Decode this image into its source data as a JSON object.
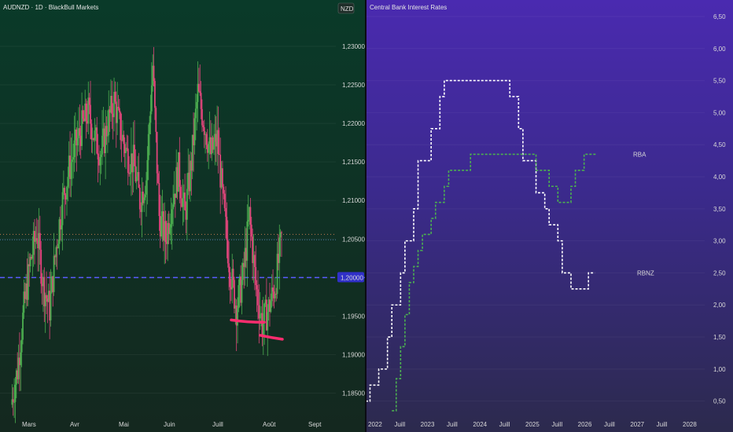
{
  "left_chart": {
    "title": "AUDNZD · 1D · BlackBull Markets",
    "currency": "NZD",
    "y_ticks": [
      "1,18500",
      "1,19000",
      "1,19500",
      "1,20000",
      "1,20500",
      "1,21000",
      "1,21500",
      "1,22000",
      "1,22500",
      "1,23000"
    ],
    "x_ticks": [
      "Mars",
      "Avr",
      "Mai",
      "Juin",
      "Juill",
      "Août",
      "Sept"
    ],
    "price_label": "1,20000",
    "colors": {
      "up": "#4caf50",
      "down": "#e0457b",
      "level": "#5b5bff",
      "marker": "#ff2d6f",
      "text": "#d8d8d8"
    }
  },
  "right_chart": {
    "title": "Central Bank Interest Rates",
    "y_ticks": [
      "0,50",
      "1,00",
      "1,50",
      "2,00",
      "2,50",
      "3,00",
      "3,50",
      "4,00",
      "4,50",
      "5,00",
      "5,50",
      "6,00",
      "6,50"
    ],
    "x_ticks": [
      "2022",
      "Juill",
      "2023",
      "Juill",
      "2024",
      "Juill",
      "2025",
      "Juill",
      "2026",
      "Juill",
      "2027",
      "Juill",
      "2028"
    ],
    "series_labels": {
      "rba": "RBA",
      "rbnz": "RBNZ"
    },
    "colors": {
      "rba": "#4caf50",
      "rbnz": "#ffffff",
      "text": "#e6e6e6"
    }
  },
  "chart_data": [
    {
      "type": "candlestick",
      "title": "AUDNZD · 1D · BlackBull Markets",
      "ylim": [
        1.182,
        1.2355
      ],
      "y_ticks": [
        1.185,
        1.19,
        1.195,
        1.2,
        1.205,
        1.21,
        1.215,
        1.22,
        1.225,
        1.23
      ],
      "x_ticks": [
        "Mars",
        "Avr",
        "Mai",
        "Juin",
        "Juill",
        "Août",
        "Sept"
      ],
      "horizontal_levels": [
        1.2,
        1.2049,
        1.2056
      ],
      "highlighted_value": 1.2,
      "close_path": [
        [
          0,
          1.1835
        ],
        [
          6,
          1.188
        ],
        [
          12,
          1.196
        ],
        [
          18,
          1.202
        ],
        [
          24,
          1.206
        ],
        [
          30,
          1.199
        ],
        [
          36,
          1.196
        ],
        [
          42,
          1.204
        ],
        [
          48,
          1.21
        ],
        [
          54,
          1.214
        ],
        [
          60,
          1.217
        ],
        [
          66,
          1.2195
        ],
        [
          72,
          1.2215
        ],
        [
          78,
          1.218
        ],
        [
          84,
          1.216
        ],
        [
          90,
          1.22
        ],
        [
          96,
          1.223
        ],
        [
          102,
          1.219
        ],
        [
          108,
          1.216
        ],
        [
          114,
          1.215
        ],
        [
          120,
          1.21
        ],
        [
          126,
          1.213
        ],
        [
          132,
          1.2275
        ],
        [
          138,
          1.208
        ],
        [
          144,
          1.205
        ],
        [
          150,
          1.21
        ],
        [
          156,
          1.214
        ],
        [
          162,
          1.208
        ],
        [
          168,
          1.215
        ],
        [
          174,
          1.224
        ],
        [
          180,
          1.22
        ],
        [
          186,
          1.216
        ],
        [
          192,
          1.218
        ],
        [
          198,
          1.209
        ],
        [
          204,
          1.201
        ],
        [
          210,
          1.196
        ],
        [
          216,
          1.2
        ],
        [
          222,
          1.208
        ],
        [
          228,
          1.199
        ],
        [
          234,
          1.194
        ],
        [
          240,
          1.196
        ],
        [
          246,
          1.199
        ],
        [
          252,
          1.205
        ]
      ],
      "annotations": [
        {
          "type": "marker",
          "from": [
            1.1945
          ],
          "to": [
            1.1942
          ]
        },
        {
          "type": "marker",
          "from": [
            1.1925
          ],
          "to": [
            1.192
          ]
        }
      ]
    },
    {
      "type": "line",
      "title": "Central Bank Interest Rates",
      "ylim": [
        0.3,
        6.72
      ],
      "x_ticks": [
        "2022",
        "Juill",
        "2023",
        "Juill",
        "2024",
        "Juill",
        "2025",
        "Juill",
        "2026",
        "Juill",
        "2027",
        "Juill",
        "2028"
      ],
      "series": [
        {
          "name": "RBNZ",
          "points": [
            [
              "2021-11",
              0.5
            ],
            [
              "2021-12",
              0.75
            ],
            [
              "2022-02",
              1.0
            ],
            [
              "2022-04",
              1.5
            ],
            [
              "2022-05",
              2.0
            ],
            [
              "2022-07",
              2.5
            ],
            [
              "2022-08",
              3.0
            ],
            [
              "2022-10",
              3.5
            ],
            [
              "2022-11",
              4.25
            ],
            [
              "2023-02",
              4.75
            ],
            [
              "2023-04",
              5.25
            ],
            [
              "2023-05",
              5.5
            ],
            [
              "2024-08",
              5.25
            ],
            [
              "2024-10",
              4.75
            ],
            [
              "2024-11",
              4.25
            ],
            [
              "2025-02",
              3.75
            ],
            [
              "2025-04",
              3.5
            ],
            [
              "2025-05",
              3.25
            ],
            [
              "2025-07",
              3.0
            ],
            [
              "2025-08",
              2.5
            ],
            [
              "2025-10",
              2.25
            ],
            [
              "2026-02",
              2.5
            ]
          ]
        },
        {
          "name": "RBA",
          "points": [
            [
              "2022-05",
              0.35
            ],
            [
              "2022-06",
              0.85
            ],
            [
              "2022-07",
              1.35
            ],
            [
              "2022-08",
              1.85
            ],
            [
              "2022-09",
              2.35
            ],
            [
              "2022-10",
              2.6
            ],
            [
              "2022-11",
              2.85
            ],
            [
              "2022-12",
              3.1
            ],
            [
              "2023-02",
              3.35
            ],
            [
              "2023-03",
              3.6
            ],
            [
              "2023-05",
              3.85
            ],
            [
              "2023-06",
              4.1
            ],
            [
              "2023-11",
              4.35
            ],
            [
              "2025-02",
              4.1
            ],
            [
              "2025-05",
              3.85
            ],
            [
              "2025-07",
              3.6
            ],
            [
              "2025-10",
              3.85
            ],
            [
              "2025-11",
              4.1
            ],
            [
              "2026-01",
              4.35
            ]
          ]
        }
      ]
    }
  ]
}
